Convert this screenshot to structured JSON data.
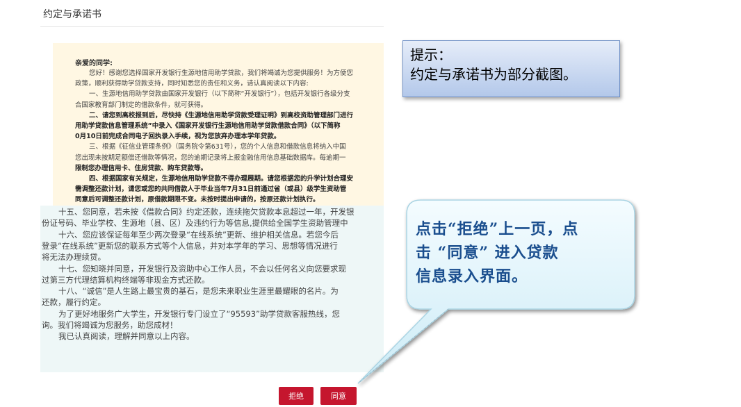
{
  "page": {
    "title": "约定与承诺书"
  },
  "agreement": {
    "greeting": "亲爱的同学:",
    "top_lines": [
      {
        "text": "您好！感谢您选择国家开发银行生源地信用助学贷款，我们将竭诚为您提供服务！为方便您",
        "bold": false,
        "indent": true
      },
      {
        "text": "政策，顺利获得助学贷款支持，同时知悉您的责任和义务，请认真阅读以下内容:",
        "bold": false,
        "indent": false
      },
      {
        "text": "一、生源地信用助学贷款由国家开发银行（以下简称“开发银行”），包括开发银行各级分支",
        "bold": false,
        "indent": true
      },
      {
        "text": "合国家教育部门制定的借款条件，就可获得。",
        "bold": false,
        "indent": false
      },
      {
        "text": "二、请您到高校报到后，尽快持《生源地信用助学贷款受理证明》到高校资助管理部门进行",
        "bold": true,
        "indent": true
      },
      {
        "text": "用助学贷款信息管理系统”中录入《国家开发银行生源地信用助学贷款借款合同》（以下简称",
        "bold": true,
        "indent": false
      },
      {
        "text": "0月10日前完成合同电子回执录入手续，视为您放弃办理本学年贷款。",
        "bold": true,
        "indent": false
      },
      {
        "text": "三、根据《征信业管理条例》（国务院令第631号），您的个人信息和借款信息将纳入中国",
        "bold": false,
        "indent": true
      },
      {
        "text": "您出现未按期足额偿还借款等情况，您的逾期记录将上报金融信用信息基础数据库。每逾期一",
        "bold": false,
        "indent": false
      },
      {
        "text": "限制您办理信用卡、住房贷款、购车贷款等。",
        "bold": true,
        "indent": false
      },
      {
        "text": "四、根据国家有关规定，生源地信用助学贷款不得办理展期。请您根据您的升学计划合理安",
        "bold": true,
        "indent": true
      },
      {
        "text": "需调整还款计划，请您或您的共同借款人于毕业当年7月31日前通过省（或县）级学生资助管",
        "bold": true,
        "indent": false
      },
      {
        "text": "同意后可调整还款计划，原借款期限不变。未按时提出申请的，按原还款计划执行。",
        "bold": true,
        "indent": false
      }
    ],
    "bottom_lines": [
      {
        "text": "十五、您同意，若未按《借款合同》约定还款，连续拖欠贷款本息超过一年，开发银",
        "indent": true
      },
      {
        "text": "份证号码、毕业学校、生源地（县、区）及违约行为等信息,提供给全国学生资助管理中",
        "indent": false
      },
      {
        "text": "十六、您应该保证每年至少两次登录“在线系统”更新、维护相关信息。若您今后",
        "indent": true
      },
      {
        "text": "登录“在线系统”更新您的联系方式等个人信息，并对本学年的学习、思想等情况进行",
        "indent": false
      },
      {
        "text": "将无法办理续贷。",
        "indent": false
      },
      {
        "text": "十七、您知晓并同意，开发银行及资助中心工作人员，不会以任何名义向您要求现",
        "indent": true
      },
      {
        "text": "过第三方代理结算机构终端等非现金方式还款。",
        "indent": false
      },
      {
        "text": "十八、“诚信”是人生路上最宝贵的基石，是您未来职业生涯里最耀眼的名片。为",
        "indent": true
      },
      {
        "text": "还款，履行约定。",
        "indent": false
      },
      {
        "text": "为了更好地服务广大学生，开发银行专门设立了“95593”助学贷款客服热线，您",
        "indent": true
      },
      {
        "text": "询。我们将竭诚为您服务，助您成材！",
        "indent": false
      },
      {
        "text": "我已认真阅读，理解并同意以上内容。",
        "indent": true
      }
    ]
  },
  "buttons": {
    "reject": "拒绝",
    "agree": "同意"
  },
  "hint": {
    "line1": "提示：",
    "line2": "约定与承诺书为部分截图。"
  },
  "callout": {
    "line1": "点击“拒绝”上一页，点",
    "line2": "击 “同意” 进入贷款",
    "line3": "信息录入界面。"
  },
  "colors": {
    "button": "#c5162e",
    "doc_top_bg": "#fff7e3",
    "doc_bottom_bg": "#eef7f7",
    "callout_text": "#1a4e8e"
  }
}
